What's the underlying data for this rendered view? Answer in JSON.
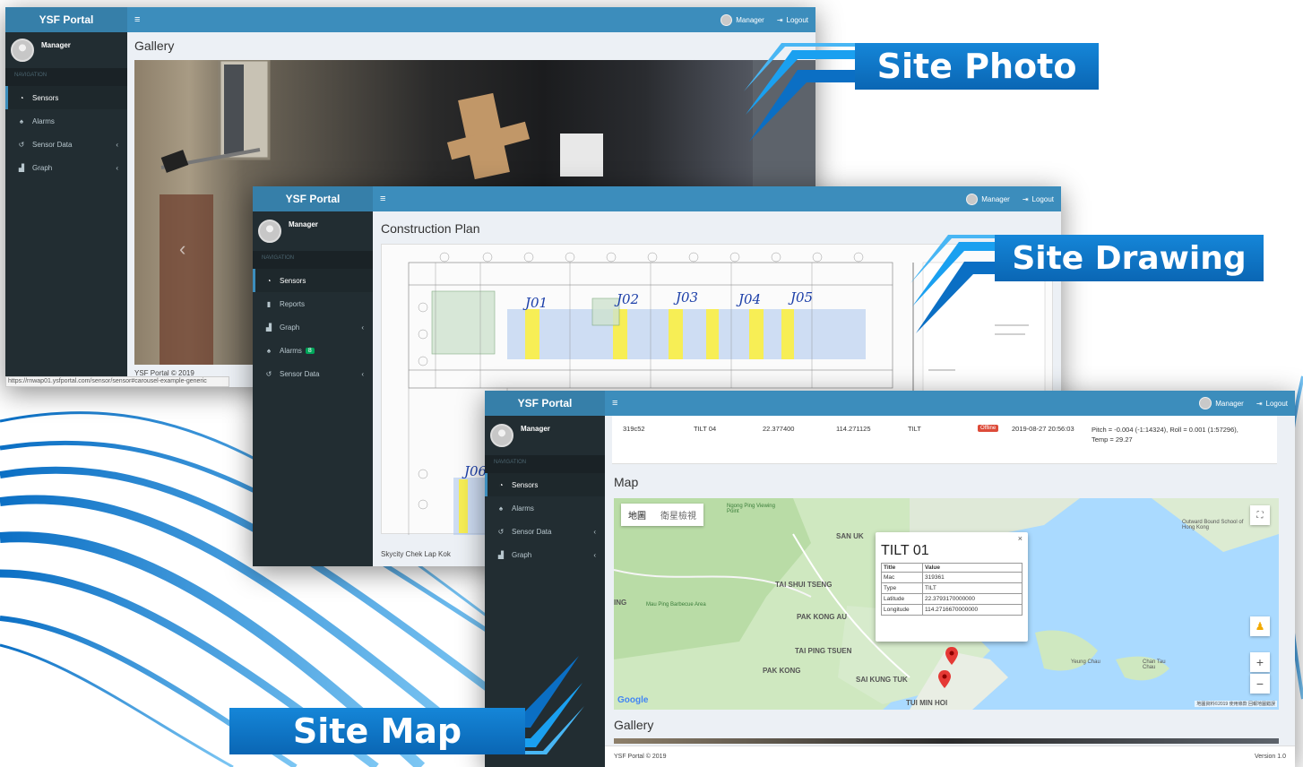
{
  "brand": "YSF Portal",
  "user": "Manager",
  "logout": "Logout",
  "nav_header": "NAVIGATION",
  "window1": {
    "title": "Gallery",
    "menu": [
      "Sensors",
      "Alarms",
      "Sensor Data",
      "Graph"
    ],
    "footer": "YSF Portal © 2019",
    "status_url": "https://rnwap01.ysfportal.com/sensor/sensor#carousel-example-generic"
  },
  "window2": {
    "title": "Construction Plan",
    "menu": [
      "Sensors",
      "Reports",
      "Graph",
      "Alarms",
      "Sensor Data"
    ],
    "alarm_badge": "8",
    "footer": "Skycity Chek Lap Kok",
    "plan_labels": [
      "J01",
      "J02",
      "J03",
      "J04",
      "J05",
      "J06"
    ]
  },
  "window3": {
    "menu": [
      "Sensors",
      "Alarms",
      "Sensor Data",
      "Graph"
    ],
    "table_row": {
      "mac": "319c52",
      "title": "TILT 04",
      "latitude": "22.377400",
      "longitude": "114.271125",
      "type": "TILT",
      "status": "Offline",
      "time": "2019-08-27 20:56:03",
      "reading": "Pitch = -0.004 (-1:14324), Roll = 0.001 (1:57296), Temp = 29.27"
    },
    "map_title": "Map",
    "map_tabs": [
      "地圖",
      "衛星檢視"
    ],
    "popup": {
      "title": "TILT 01",
      "headers": [
        "Title",
        "Value"
      ],
      "rows": [
        [
          "Mac",
          "319361"
        ],
        [
          "Type",
          "TILT"
        ],
        [
          "Latitude",
          "22.3793170000000"
        ],
        [
          "Longitude",
          "114.2716670000000"
        ]
      ]
    },
    "place_names": [
      "SAN UK",
      "TAI SHUI TSENG",
      "PAK KONG AU",
      "TAI PING TSUEN",
      "PAK KONG",
      "SAI KUNG TUK",
      "TUI MIN HOI",
      "ING",
      "Yeung Chau",
      "Chan Tau Chau",
      "Ngong Ping Viewing Point",
      "Mau Ping Barbecue Area",
      "Outward Bound School of Hong Kong"
    ],
    "google": "Google",
    "map_footer": "地圖資料©2019  使用條款  回報地圖錯誤",
    "gallery_title": "Gallery",
    "footer": "YSF Portal © 2019",
    "version": "Version 1.0"
  },
  "callouts": {
    "photo": "Site Photo",
    "drawing": "Site Drawing",
    "map": "Site Map"
  },
  "icons": [
    "hamburger-icon",
    "logout-icon",
    "dashboard-icon",
    "bell-icon",
    "history-icon",
    "area-chart-icon",
    "file-icon",
    "chevron-left-icon",
    "map-marker-icon",
    "pegman-icon",
    "zoom-in-icon",
    "zoom-out-icon",
    "fullscreen-icon",
    "close-icon"
  ]
}
